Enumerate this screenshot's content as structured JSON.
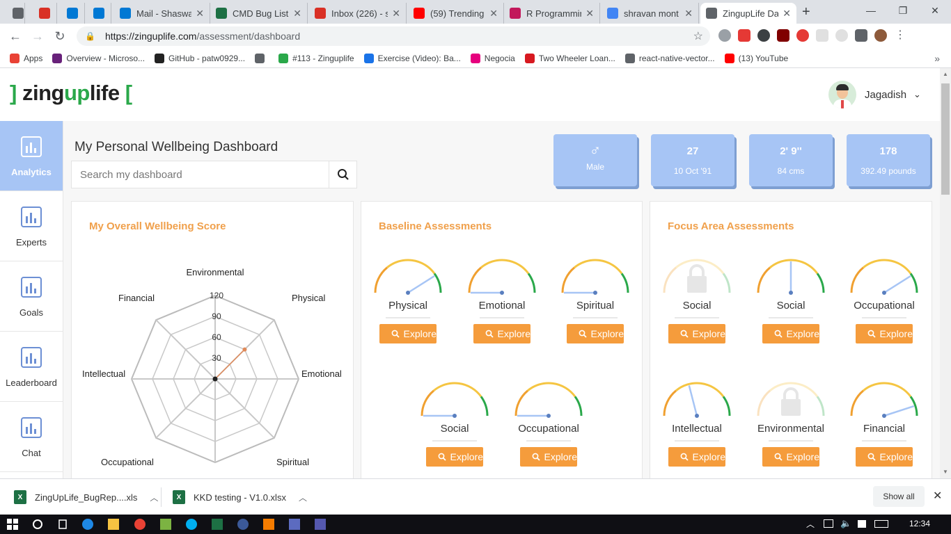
{
  "browser": {
    "tabs": [
      {
        "title": "",
        "icon": "gray-extension-icon",
        "color": "#5f6368"
      },
      {
        "title": "",
        "icon": "gmail-icon",
        "color": "#d93025"
      },
      {
        "title": "",
        "icon": "azure-devops-icon",
        "color": "#0078d4"
      },
      {
        "title": "",
        "icon": "azure-devops-icon",
        "color": "#0078d4"
      },
      {
        "title": "Mail - Shaswat",
        "icon": "outlook-icon",
        "color": "#0078d4"
      },
      {
        "title": "CMD Bug List.",
        "icon": "excel-icon",
        "color": "#1d7044"
      },
      {
        "title": "Inbox (226) - s",
        "icon": "gmail-icon",
        "color": "#d93025"
      },
      {
        "title": "(59) Trending",
        "icon": "youtube-icon",
        "color": "#ff0000"
      },
      {
        "title": "R Programmin",
        "icon": "r-icon",
        "color": "#c2185b"
      },
      {
        "title": "shravan mont",
        "icon": "google-icon",
        "color": "#4285f4"
      },
      {
        "title": "ZingupLife Da",
        "icon": "globe-icon",
        "color": "#5f6368"
      }
    ],
    "url_host": "https://zinguplife.com",
    "url_path": "/assessment/dashboard",
    "bookmarks": [
      {
        "label": "Apps",
        "color": "#e94235"
      },
      {
        "label": "Overview - Microso...",
        "color": "#68217a"
      },
      {
        "label": "GitHub - patw0929...",
        "color": "#222222"
      },
      {
        "label": "",
        "color": "#5f6368"
      },
      {
        "label": "#113 - Zinguplife",
        "color": "#2aa84a"
      },
      {
        "label": "Exercise (Video): Ba...",
        "color": "#1a73e8"
      },
      {
        "label": "Negocia",
        "color": "#e6007e"
      },
      {
        "label": "Two Wheeler Loan...",
        "color": "#d71920"
      },
      {
        "label": "react-native-vector...",
        "color": "#5f6368"
      },
      {
        "label": "(13) YouTube",
        "color": "#ff0000"
      }
    ]
  },
  "app": {
    "logo_open": "]",
    "logo_a": "zing",
    "logo_b": "up",
    "logo_c": "life",
    "logo_close": "[",
    "user_name": "Jagadish",
    "sidebar": [
      {
        "label": "Analytics",
        "icon": "analytics-icon"
      },
      {
        "label": "Experts",
        "icon": "experts-icon"
      },
      {
        "label": "Goals",
        "icon": "goals-icon"
      },
      {
        "label": "Leaderboard",
        "icon": "leaderboard-icon"
      },
      {
        "label": "Chat",
        "icon": "chat-icon"
      }
    ],
    "dashboard_title": "My Personal Wellbeing Dashboard",
    "search_placeholder": "Search my dashboard",
    "stats": [
      {
        "top": "♂",
        "bottom": "Male"
      },
      {
        "top": "27",
        "bottom": "10 Oct '91"
      },
      {
        "top": "2' 9''",
        "bottom": "84 cms"
      },
      {
        "top": "178",
        "bottom": "392.49 pounds"
      }
    ],
    "overall": {
      "title": "My Overall Wellbeing Score",
      "axes": [
        "Environmental",
        "Physical",
        "Emotional",
        "Spiritual",
        "",
        "Occupational",
        "Intellectual",
        "Financial"
      ],
      "ticks": [
        "30",
        "60",
        "90",
        "120"
      ],
      "max": 120,
      "values": [
        0,
        60,
        0,
        0,
        0,
        0,
        0,
        0
      ]
    },
    "baseline": {
      "title": "Baseline Assessments",
      "items": [
        {
          "label": "Physical",
          "value": 0.82,
          "locked": false
        },
        {
          "label": "Emotional",
          "value": 0.0,
          "locked": false
        },
        {
          "label": "Spiritual",
          "value": 0.0,
          "locked": false
        },
        {
          "label": "Social",
          "value": 0.0,
          "locked": false
        },
        {
          "label": "Occupational",
          "value": 0.0,
          "locked": false
        }
      ]
    },
    "focus": {
      "title": "Focus Area Assessments",
      "items": [
        {
          "label": "Social",
          "value": 0.0,
          "locked": true
        },
        {
          "label": "Social",
          "value": 0.5,
          "locked": false
        },
        {
          "label": "Occupational",
          "value": 0.82,
          "locked": false
        },
        {
          "label": "Intellectual",
          "value": 0.42,
          "locked": false
        },
        {
          "label": "Environmental",
          "value": 0.0,
          "locked": true
        },
        {
          "label": "Financial",
          "value": 0.9,
          "locked": false
        }
      ]
    },
    "explore_label": "Explore"
  },
  "downloads": [
    {
      "name": "ZingUpLife_BugRep....xls"
    },
    {
      "name": "KKD testing - V1.0.xlsx"
    }
  ],
  "show_all": "Show all",
  "clock": "12:34",
  "colors": {
    "accent": "#f59c3c",
    "primary_blue": "#a7c5f5",
    "green": "#2aa84a"
  }
}
